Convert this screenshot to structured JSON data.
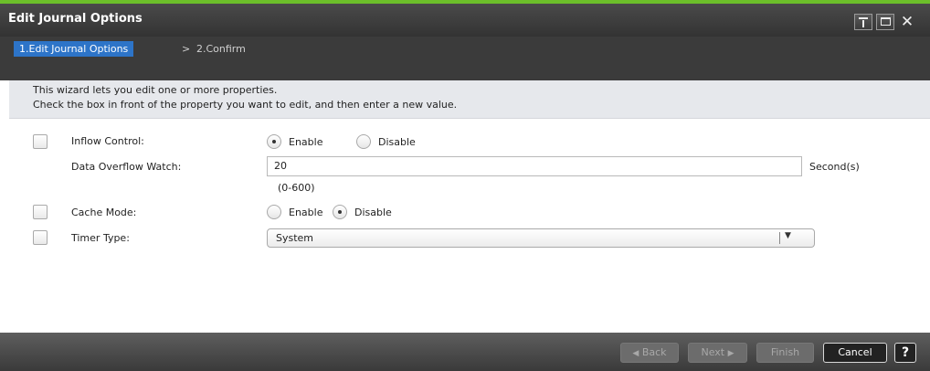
{
  "window": {
    "title": "Edit Journal Options",
    "accent_color": "#6cbf2a",
    "controls": {
      "pin_icon": "pin-icon",
      "maximize_icon": "maximize-icon",
      "close_icon": "close-icon"
    },
    "close_glyph": "✕"
  },
  "steps": {
    "active": "1.Edit Journal Options",
    "separator": ">",
    "next": "2.Confirm",
    "active_color": "#2d74c8"
  },
  "description": {
    "line1": "This wizard lets you edit one or more properties.",
    "line2": "Check the box in front of the property you want to edit, and then enter a new value."
  },
  "form": {
    "inflow_control": {
      "label": "Inflow Control:",
      "checked": false,
      "enable_label": "Enable",
      "disable_label": "Disable",
      "selected": "Enable"
    },
    "data_overflow_watch": {
      "label": "Data Overflow Watch:",
      "value": "20",
      "unit": "Second(s)",
      "range": "(0-600)"
    },
    "cache_mode": {
      "label": "Cache Mode:",
      "checked": false,
      "enable_label": "Enable",
      "disable_label": "Disable",
      "selected": "Disable"
    },
    "timer_type": {
      "label": "Timer Type:",
      "checked": false,
      "selected": "System"
    }
  },
  "footer": {
    "back": "Back",
    "next": "Next",
    "finish": "Finish",
    "cancel": "Cancel",
    "help": "?"
  }
}
